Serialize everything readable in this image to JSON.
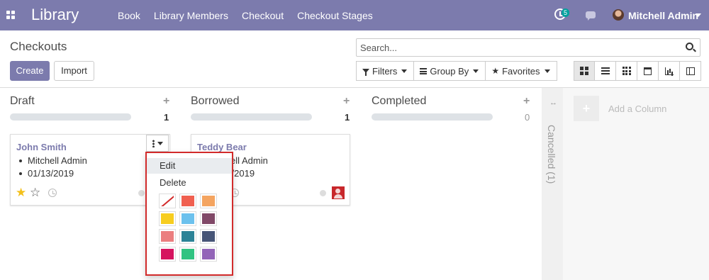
{
  "navbar": {
    "app_name": "Library",
    "menu": [
      "Book",
      "Library Members",
      "Checkout",
      "Checkout Stages"
    ],
    "activity_count": "5",
    "user_name": "Mitchell Admin",
    "accent_color": "#7c7bad"
  },
  "control_panel": {
    "title": "Checkouts",
    "create_label": "Create",
    "import_label": "Import",
    "search_placeholder": "Search...",
    "filters_label": "Filters",
    "group_by_label": "Group By",
    "favorites_label": "Favorites",
    "views": [
      "kanban",
      "list",
      "grid",
      "calendar",
      "graph",
      "pivot"
    ],
    "active_view": "kanban"
  },
  "columns": [
    {
      "title": "Draft",
      "count": "1",
      "plus": "+",
      "cards": [
        {
          "name": "John Smith",
          "details": [
            "Mitchell Admin",
            "01/13/2019"
          ],
          "starred": true
        }
      ]
    },
    {
      "title": "Borrowed",
      "count": "1",
      "plus": "+",
      "cards": [
        {
          "name": "Teddy Bear",
          "details": [
            "Mitchell Admin",
            "01/15/2019"
          ],
          "starred": false
        }
      ]
    },
    {
      "title": "Completed",
      "count": "0",
      "plus": "+",
      "cards": []
    }
  ],
  "folded_column": {
    "title": "Cancelled (1)",
    "arrow": "↔"
  },
  "add_column": {
    "plus": "+",
    "label": "Add a Column"
  },
  "card_menu": {
    "items": [
      "Edit",
      "Delete"
    ],
    "colors": [
      "none",
      "#f06050",
      "#f4a460",
      "#f7cd1f",
      "#6cc1ed",
      "#814968",
      "#eb7e7f",
      "#2c8397",
      "#475577",
      "#d6145f",
      "#30c381",
      "#9365b8"
    ]
  },
  "icons": {
    "star_filled": "★",
    "star_empty": "☆"
  }
}
